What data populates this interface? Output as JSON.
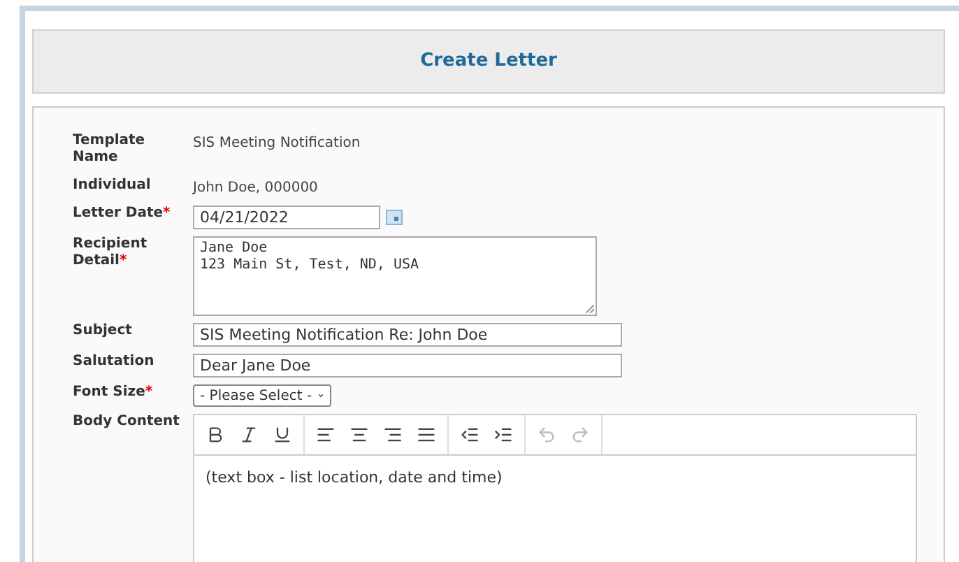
{
  "header": {
    "title": "Create Letter"
  },
  "fields": [
    {
      "kind": "static",
      "label": "Template Name",
      "value": "SIS Meeting Notification"
    },
    {
      "kind": "static",
      "label": "Individual",
      "value": "John Doe, 000000"
    },
    {
      "kind": "date",
      "label": "Letter Date",
      "required_mark": "*",
      "value": "04/21/2022"
    },
    {
      "kind": "textarea",
      "label": "Recipient Detail",
      "required_mark": "*",
      "value": "Jane Doe\n123 Main St, Test, ND, USA"
    },
    {
      "kind": "text",
      "label": "Subject",
      "value": "SIS Meeting Notification Re: John Doe"
    },
    {
      "kind": "text",
      "label": "Salutation",
      "value": "Dear Jane Doe"
    },
    {
      "kind": "select",
      "label": "Font Size",
      "required_mark": "*",
      "value": "- Please Select -"
    },
    {
      "kind": "editor",
      "label": "Body Content",
      "value": "(text box - list location, date and time)"
    }
  ],
  "toolbar": [
    [
      {
        "kind": "bold",
        "disabled": false
      },
      {
        "kind": "italic",
        "disabled": false
      },
      {
        "kind": "underline",
        "disabled": false
      }
    ],
    [
      {
        "kind": "align-left",
        "disabled": false
      },
      {
        "kind": "align-center",
        "disabled": false
      },
      {
        "kind": "align-right",
        "disabled": false
      },
      {
        "kind": "justify",
        "disabled": false
      }
    ],
    [
      {
        "kind": "outdent",
        "disabled": false
      },
      {
        "kind": "indent",
        "disabled": false
      }
    ],
    [
      {
        "kind": "undo",
        "disabled": true
      },
      {
        "kind": "redo",
        "disabled": true
      }
    ]
  ]
}
